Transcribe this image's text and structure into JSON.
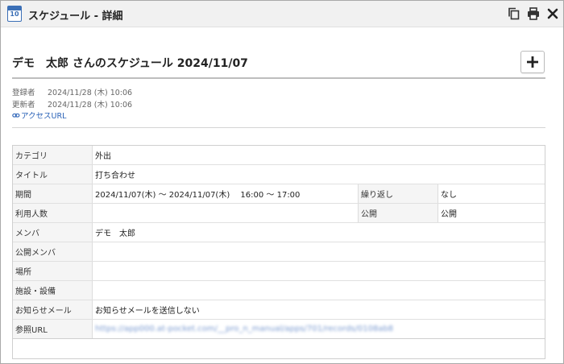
{
  "window": {
    "title": "スケジュール - 詳細",
    "icon_label": "10",
    "buttons": [
      "copy-icon",
      "print-icon",
      "close-icon"
    ]
  },
  "schedule": {
    "heading": "デモ　太郎 さんのスケジュール 2024/11/07",
    "add_button": "plus-icon"
  },
  "meta": {
    "registered_label": "登録者",
    "registered_value": "2024/11/28 (木) 10:06",
    "updated_label": "更新者",
    "updated_value": "2024/11/28 (木) 10:06",
    "access_url_label": "アクセスURL"
  },
  "details": {
    "category_label": "カテゴリ",
    "category_value": "外出",
    "title_label": "タイトル",
    "title_value": "打ち合わせ",
    "period_label": "期間",
    "period_value": "2024/11/07(木) 〜 2024/11/07(木)　 16:00 〜 17:00",
    "repeat_label": "繰り返し",
    "repeat_value": "なし",
    "users_label": "利用人数",
    "users_value": "",
    "public_label": "公開",
    "public_value": "公開",
    "members_label": "メンバ",
    "members_value": "デモ　太郎",
    "public_members_label": "公開メンバ",
    "public_members_value": "",
    "place_label": "場所",
    "place_value": "",
    "facility_label": "施設・設備",
    "facility_value": "",
    "notify_label": "お知らせメール",
    "notify_value": "お知らせメールを送信しない",
    "ref_url_label": "参照URL",
    "ref_url_value": "https://app000.at-pocket.com/__pro_n_manual/apps/701/records/0108ab8"
  },
  "colors": {
    "titlebar_bg": "#f1f1f1",
    "link": "#2a62b7",
    "header_cell_bg": "#f5f5f5"
  }
}
